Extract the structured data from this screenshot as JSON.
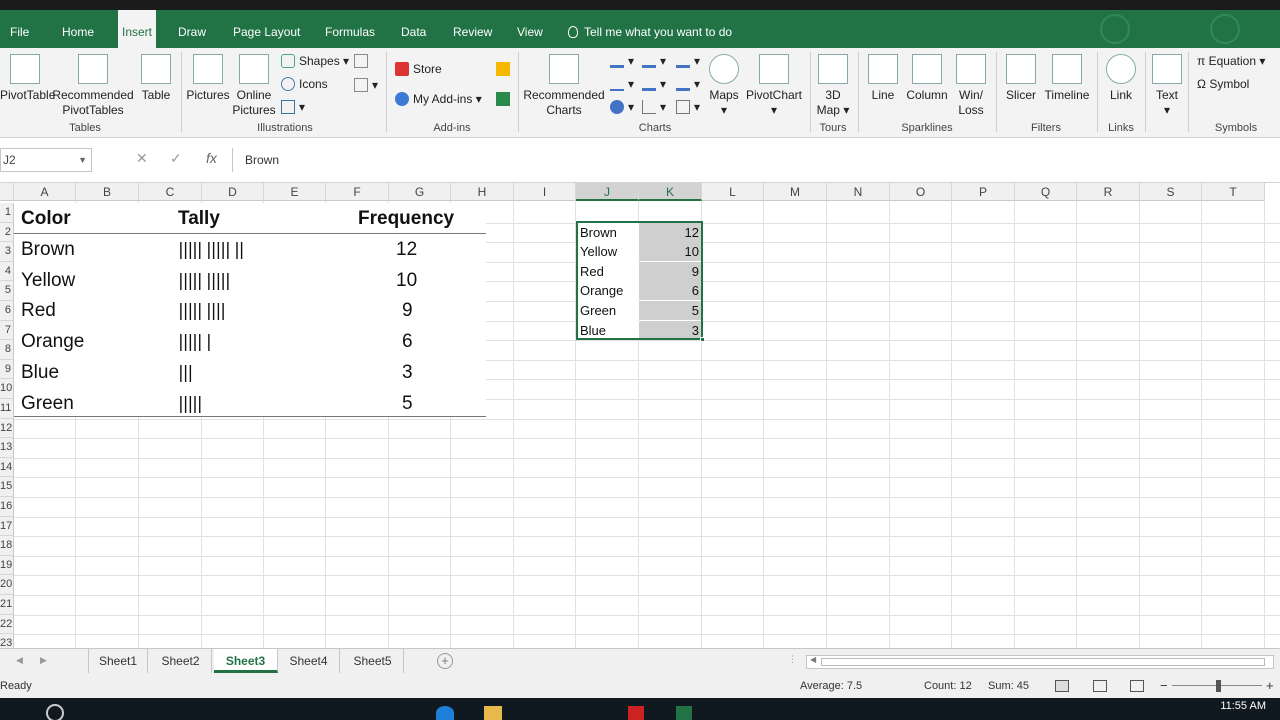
{
  "ribbon_tabs": [
    "File",
    "Home",
    "Insert",
    "Draw",
    "Page Layout",
    "Formulas",
    "Data",
    "Review",
    "View"
  ],
  "active_tab": "Insert",
  "tell_me": "Tell me what you want to do",
  "groups": {
    "tables": {
      "label": "Tables",
      "pivot": "PivotTable",
      "recommended": "Recommended",
      "recommended2": "PivotTables",
      "table": "Table"
    },
    "illustrations": {
      "label": "Illustrations",
      "pictures": "Pictures",
      "online": "Online",
      "online2": "Pictures",
      "shapes": "Shapes",
      "icons": "Icons"
    },
    "addins": {
      "label": "Add-ins",
      "store": "Store",
      "myaddins": "My Add-ins"
    },
    "charts": {
      "label": "Charts",
      "recommended": "Recommended",
      "recommended2": "Charts",
      "maps": "Maps",
      "pivotchart": "PivotChart"
    },
    "tours": {
      "label": "Tours",
      "map3d": "3D",
      "map3d2": "Map"
    },
    "sparklines": {
      "label": "Sparklines",
      "line": "Line",
      "column": "Column",
      "winloss": "Win/",
      "winloss2": "Loss"
    },
    "filters": {
      "label": "Filters",
      "slicer": "Slicer",
      "timeline": "Timeline"
    },
    "links": {
      "label": "Links",
      "link": "Link"
    },
    "text": {
      "label": "Text",
      "text": "Text"
    },
    "symbols": {
      "label": "Symbols",
      "equation": "Equation",
      "symbol": "Symbol"
    }
  },
  "formula_bar": {
    "name_box": "J2",
    "content": "Brown"
  },
  "columns": [
    "A",
    "B",
    "C",
    "D",
    "E",
    "F",
    "G",
    "H",
    "I",
    "J",
    "K",
    "L",
    "M",
    "N",
    "O",
    "P",
    "Q",
    "R",
    "S",
    "T"
  ],
  "rows": [
    "1",
    "2",
    "3",
    "4",
    "5",
    "6",
    "7",
    "8",
    "9",
    "10",
    "11",
    "12",
    "13",
    "14",
    "15",
    "16",
    "17",
    "18",
    "19",
    "20",
    "21",
    "22",
    "23"
  ],
  "picture_table": {
    "headers": [
      "Color",
      "Tally",
      "Frequency"
    ],
    "rows": [
      {
        "color": "Brown",
        "tally": "||||| ||||| ||",
        "freq": "12"
      },
      {
        "color": "Yellow",
        "tally": "||||| |||||",
        "freq": "10"
      },
      {
        "color": "Red",
        "tally": "||||| ||||",
        "freq": "9"
      },
      {
        "color": "Orange",
        "tally": "||||| |",
        "freq": "6"
      },
      {
        "color": "Blue",
        "tally": "|||",
        "freq": "3"
      },
      {
        "color": "Green",
        "tally": "|||||",
        "freq": "5"
      }
    ]
  },
  "data_range": [
    {
      "name": "Brown",
      "value": "12"
    },
    {
      "name": "Yellow",
      "value": "10"
    },
    {
      "name": "Red",
      "value": "9"
    },
    {
      "name": "Orange",
      "value": "6"
    },
    {
      "name": "Green",
      "value": "5"
    },
    {
      "name": "Blue",
      "value": "3"
    }
  ],
  "sheets": [
    "Sheet1",
    "Sheet2",
    "Sheet3",
    "Sheet4",
    "Sheet5"
  ],
  "active_sheet": "Sheet3",
  "status": {
    "ready": "Ready",
    "average": "Average: 7.5",
    "count": "Count: 12",
    "sum": "Sum: 45"
  },
  "clock": "11:55 AM"
}
